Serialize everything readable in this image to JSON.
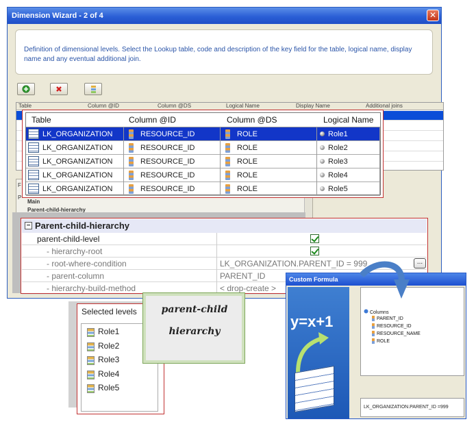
{
  "wizard": {
    "title": "Dimension Wizard - 2 of 4",
    "close_glyph": "✕",
    "description": "Definition of dimensional levels. Select the Lookup table, code and description of the key field for the table, logical name, display name and any eventual additional join.",
    "toolbar": {
      "add_icon": "add-icon",
      "delete_icon": "delete-icon",
      "levels_icon": "levels-icon"
    },
    "bg_headers": [
      "Table",
      "Column @ID",
      "Column @DS",
      "Logical Name",
      "Display Name",
      "Additional joins"
    ],
    "lower": {
      "main": "Main",
      "pch": "Parent-child-hierarchy",
      "pcl": "parent-child-level",
      "label_f": "F",
      "label_p": "P"
    }
  },
  "levels_table": {
    "headers": [
      "Table",
      "Column @ID",
      "Column @DS",
      "Logical Name"
    ],
    "rows": [
      {
        "table": "LK_ORGANIZATION",
        "id": "RESOURCE_ID",
        "ds": "ROLE",
        "logical": "Role1"
      },
      {
        "table": "LK_ORGANIZATION",
        "id": "RESOURCE_ID",
        "ds": "ROLE",
        "logical": "Role2"
      },
      {
        "table": "LK_ORGANIZATION",
        "id": "RESOURCE_ID",
        "ds": "ROLE",
        "logical": "Role3"
      },
      {
        "table": "LK_ORGANIZATION",
        "id": "RESOURCE_ID",
        "ds": "ROLE",
        "logical": "Role4"
      },
      {
        "table": "LK_ORGANIZATION",
        "id": "RESOURCE_ID",
        "ds": "ROLE",
        "logical": "Role5"
      }
    ]
  },
  "hierarchy": {
    "header": "Parent-child-hierarchy",
    "rows": [
      {
        "label": "parent-child-level",
        "value": "",
        "checked": true
      },
      {
        "label": "- hierarchy-root",
        "value": "",
        "checked": true
      },
      {
        "label": "- root-where-condition",
        "value": "LK_ORGANIZATION.PARENT_ID = 999",
        "button": "..."
      },
      {
        "label": "- parent-column",
        "value": "PARENT_ID"
      },
      {
        "label": "- hierarchy-build-method",
        "value": "< drop-create >"
      }
    ]
  },
  "selected_levels": {
    "title": "Selected levels",
    "items": [
      "Role1",
      "Role2",
      "Role3",
      "Role4",
      "Role5"
    ]
  },
  "callout": {
    "line1": "parent-child",
    "line2": "hierarchy"
  },
  "custom_formula": {
    "title": "Custom Formula",
    "formula_art": "y=x+1",
    "tree_root": "Columns",
    "tree_items": [
      "PARENT_ID",
      "RESOURCE_ID",
      "RESOURCE_NAME",
      "ROLE"
    ],
    "expression": "LK_ORGANIZATION.PARENT_ID =999"
  },
  "colors": {
    "accent_red": "#c03030",
    "selection_blue": "#1236c8",
    "title_blue": "#2b5fd6"
  }
}
